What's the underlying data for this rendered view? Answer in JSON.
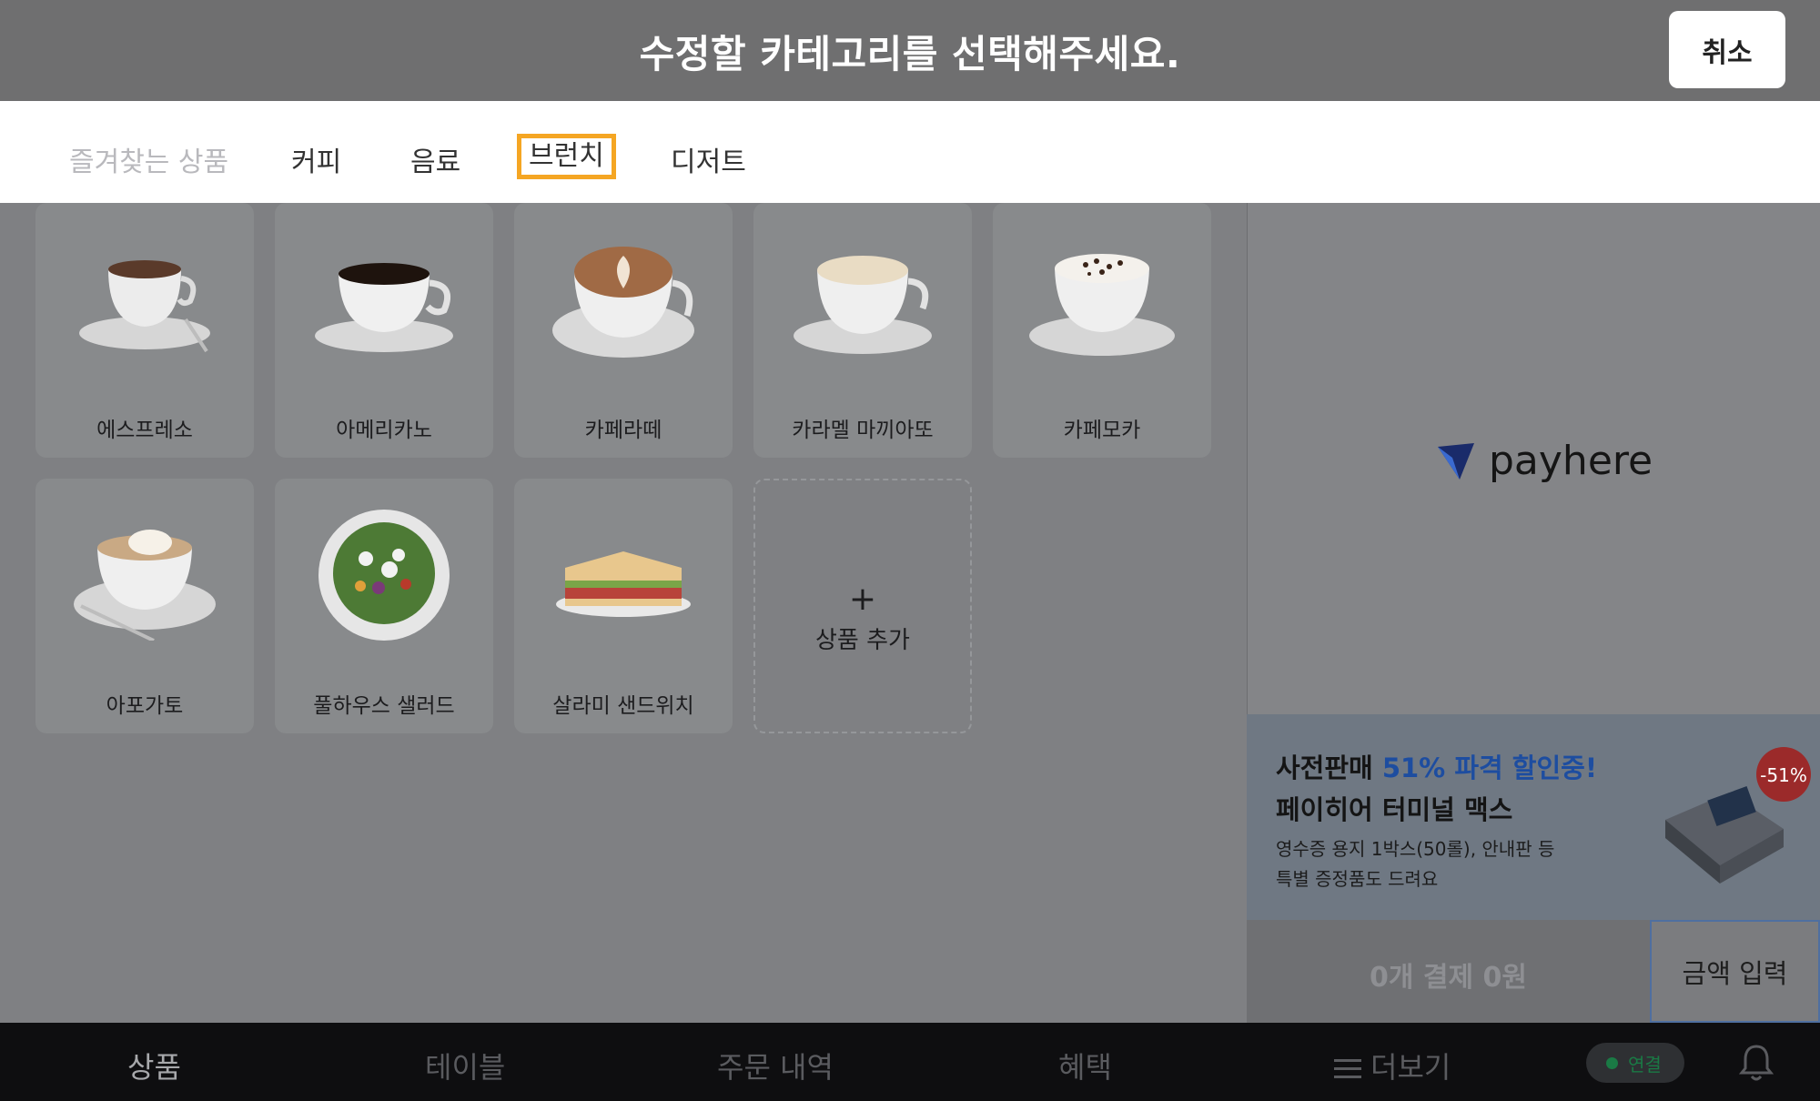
{
  "topbar": {
    "title": "수정할 카테고리를 선택해주세요.",
    "cancel_label": "취소"
  },
  "tabs": [
    {
      "label": "즐겨찾는 상품",
      "state": "disabled"
    },
    {
      "label": "커피",
      "state": "normal"
    },
    {
      "label": "음료",
      "state": "normal"
    },
    {
      "label": "브런치",
      "state": "selected"
    },
    {
      "label": "디저트",
      "state": "normal"
    }
  ],
  "products": [
    {
      "name": "에스프레소",
      "icon": "espresso-cup"
    },
    {
      "name": "아메리카노",
      "icon": "americano-cup"
    },
    {
      "name": "카페라떼",
      "icon": "latte-cup"
    },
    {
      "name": "카라멜 마끼아또",
      "icon": "macchiato-cup"
    },
    {
      "name": "카페모카",
      "icon": "mocha-cup"
    },
    {
      "name": "아포가토",
      "icon": "affogato-cup"
    },
    {
      "name": "풀하우스 샐러드",
      "icon": "salad-bowl"
    },
    {
      "name": "살라미 샌드위치",
      "icon": "sandwich"
    }
  ],
  "add_product": {
    "plus": "+",
    "label": "상품 추가"
  },
  "brand": {
    "name": "payhere"
  },
  "promo": {
    "line1_prefix": "사전판매 ",
    "line1_accent": "51% 파격 할인중!",
    "line2": "페이히어 터미널 맥스",
    "line3": "영수증 용지 1박스(50롤), 안내판 등",
    "line4": "특별 증정품도 드려요",
    "badge": "-51%",
    "accent_color": "#1d4da0",
    "badge_color": "#9b2a2a"
  },
  "payment": {
    "summary": "0개 결제  0원",
    "amount_button": "금액 입력"
  },
  "bottom_nav": {
    "items": [
      "상품",
      "테이블",
      "주문 내역",
      "혜택",
      "더보기"
    ],
    "status": "연결"
  }
}
